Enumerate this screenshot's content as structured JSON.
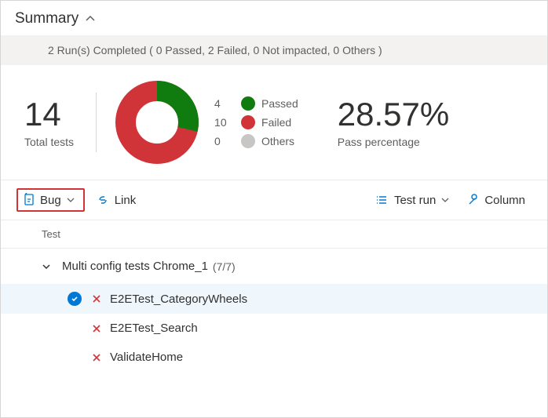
{
  "header": {
    "title": "Summary"
  },
  "status": {
    "text": "2 Run(s) Completed ( 0 Passed, 2 Failed, 0 Not impacted, 0 Others )"
  },
  "totals": {
    "total_count": "14",
    "total_label": "Total tests",
    "pass_pct": "28.57%",
    "pass_label": "Pass percentage"
  },
  "legend": {
    "passed": {
      "n": "4",
      "label": "Passed"
    },
    "failed": {
      "n": "10",
      "label": "Failed"
    },
    "others": {
      "n": "0",
      "label": "Others"
    }
  },
  "chart_data": {
    "type": "pie",
    "title": "",
    "categories": [
      "Passed",
      "Failed",
      "Others"
    ],
    "values": [
      4,
      10,
      0
    ],
    "colors": [
      "#107c10",
      "#d13438",
      "#c8c6c4"
    ]
  },
  "toolbar": {
    "bug": "Bug",
    "link": "Link",
    "test_run": "Test run",
    "column": "Column"
  },
  "columns": {
    "test": "Test"
  },
  "group": {
    "name": "Multi config tests Chrome_1",
    "count": "(7/7)"
  },
  "tests": [
    {
      "name": "E2ETest_CategoryWheels",
      "selected": true
    },
    {
      "name": "E2ETest_Search",
      "selected": false
    },
    {
      "name": "ValidateHome",
      "selected": false
    }
  ]
}
